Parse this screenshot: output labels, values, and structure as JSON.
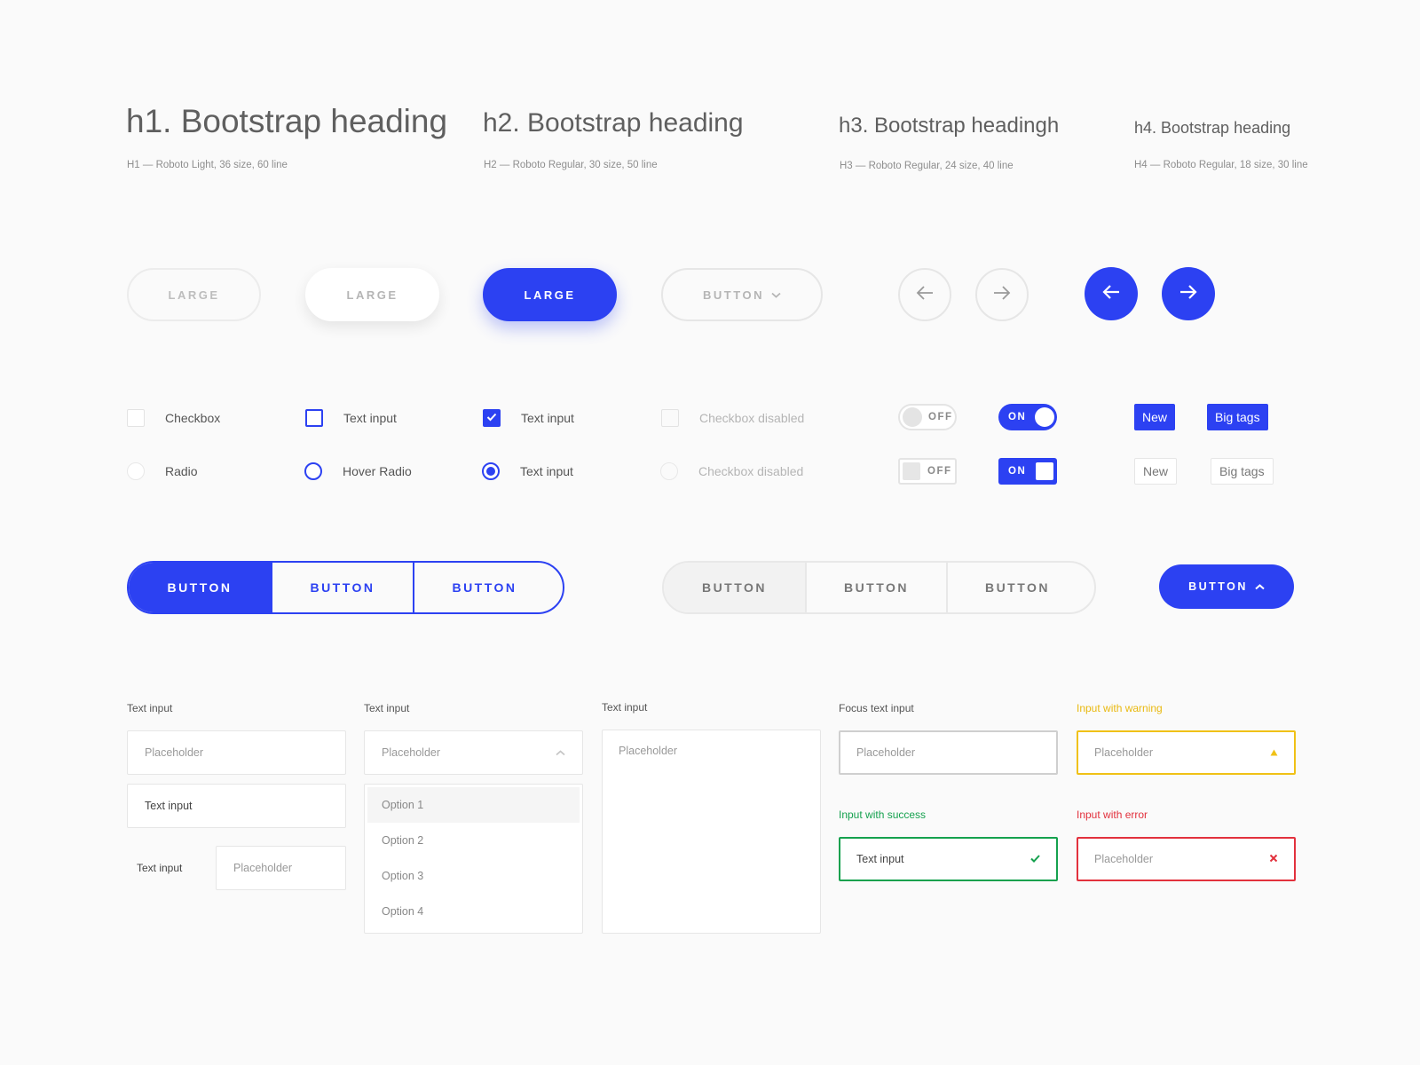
{
  "headings": {
    "h1": {
      "text": "h1. Bootstrap heading",
      "caption": "H1 — Roboto Light, 36 size, 60 line"
    },
    "h2": {
      "text": "h2. Bootstrap heading",
      "caption": "H2 — Roboto Regular, 30 size, 50 line"
    },
    "h3": {
      "text": "h3. Bootstrap headingh",
      "caption": "H3 — Roboto Regular, 24 size, 40 line"
    },
    "h4": {
      "text": "h4. Bootstrap heading",
      "caption": "H4 — Roboto Regular, 18 size, 30 line"
    }
  },
  "buttons": {
    "large_ghost": "LARGE",
    "large_white": "LARGE",
    "large_blue": "LARGE",
    "dropdown": "BUTTON",
    "icons": {
      "left": "arrow-left-icon",
      "right": "arrow-right-icon"
    }
  },
  "checks": {
    "checkbox": "Checkbox",
    "checkbox_hover": "Text input",
    "checkbox_checked": "Text input",
    "checkbox_disabled": "Checkbox disabled",
    "radio": "Radio",
    "radio_hover": "Hover Radio",
    "radio_checked": "Text input",
    "radio_disabled": "Checkbox disabled"
  },
  "toggles": {
    "off": "OFF",
    "on": "ON"
  },
  "tags": {
    "new": "New",
    "big": "Big tags"
  },
  "segmented": {
    "blue": [
      "BUTTON",
      "BUTTON",
      "BUTTON"
    ],
    "grey": [
      "BUTTON",
      "BUTTON",
      "BUTTON"
    ],
    "single": "BUTTON"
  },
  "inputs": {
    "col1": {
      "label": "Text input",
      "placeholder": "Placeholder",
      "value": "Text input",
      "inline_label": "Text input",
      "inline_placeholder": "Placeholder"
    },
    "col2": {
      "label": "Text input",
      "placeholder": "Placeholder",
      "options": [
        "Option 1",
        "Option 2",
        "Option 3",
        "Option 4"
      ]
    },
    "col3": {
      "label": "Text input",
      "placeholder": "Placeholder"
    },
    "col4": {
      "focus_label": "Focus text input",
      "focus_placeholder": "Placeholder",
      "success_label": "Input with success",
      "success_value": "Text input"
    },
    "col5": {
      "warning_label": "Input with warning",
      "warning_placeholder": "Placeholder",
      "error_label": "Input with error",
      "error_placeholder": "Placeholder"
    }
  },
  "colors": {
    "accent": "#2c41f2",
    "warning": "#f0c116",
    "success": "#15a14e",
    "error": "#e2313d"
  }
}
